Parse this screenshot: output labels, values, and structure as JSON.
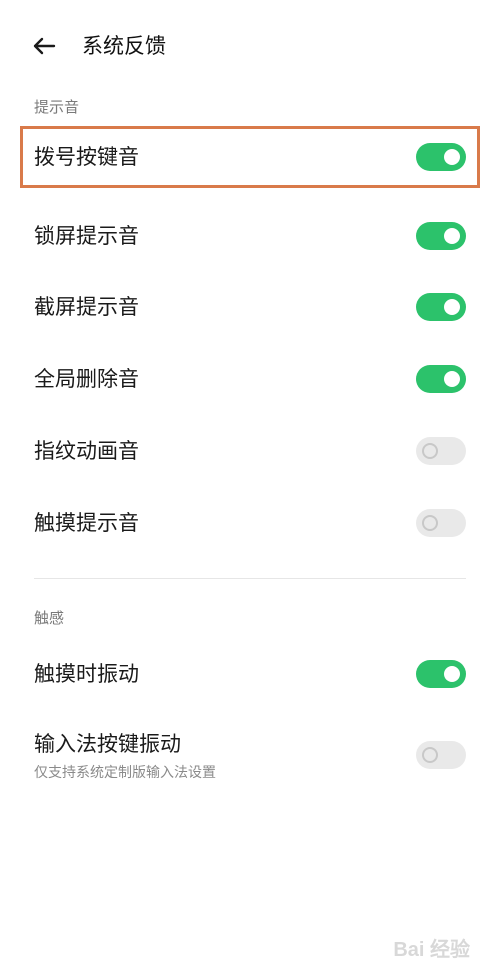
{
  "header": {
    "title": "系统反馈"
  },
  "sections": [
    {
      "title": "提示音",
      "items": [
        {
          "label": "拨号按键音",
          "on": true
        },
        {
          "label": "锁屏提示音",
          "on": true
        },
        {
          "label": "截屏提示音",
          "on": true
        },
        {
          "label": "全局删除音",
          "on": true
        },
        {
          "label": "指纹动画音",
          "on": false
        },
        {
          "label": "触摸提示音",
          "on": false
        }
      ]
    },
    {
      "title": "触感",
      "items": [
        {
          "label": "触摸时振动",
          "on": true
        },
        {
          "label": "输入法按键振动",
          "sub": "仅支持系统定制版输入法设置",
          "on": false
        }
      ]
    }
  ],
  "watermark": {
    "text": "Bai 经验"
  },
  "colors": {
    "toggle_on": "#2cc26b",
    "toggle_off": "#e9e9e9",
    "highlight": "#d97a4a"
  }
}
